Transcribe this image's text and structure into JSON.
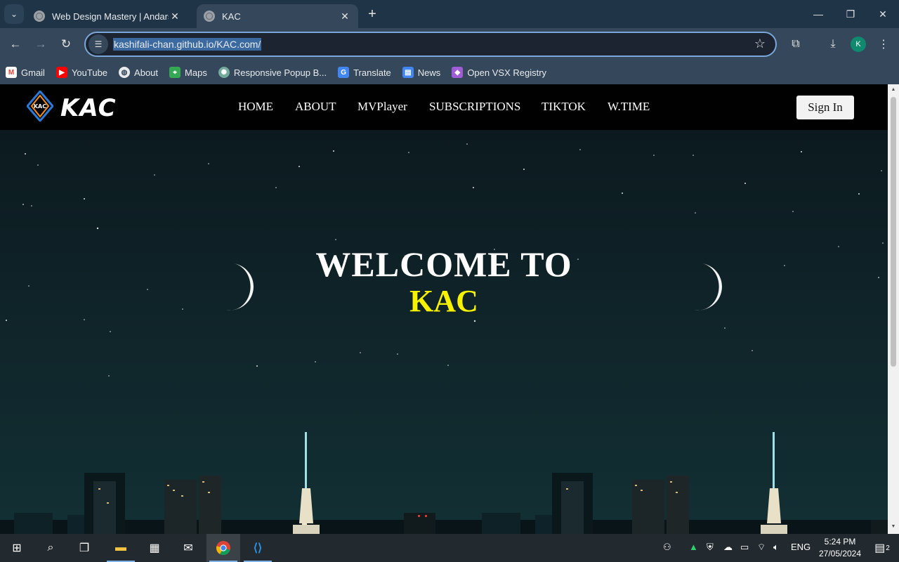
{
  "browser": {
    "tabs": [
      {
        "title": "Web Design Mastery | Andarson",
        "active": false
      },
      {
        "title": "KAC",
        "active": true
      }
    ],
    "url": "kashifali-chan.github.io/KAC.com/",
    "profile_initial": "K",
    "bookmarks": [
      {
        "label": "Gmail",
        "icon": "gmail-icon",
        "color": "#ea4335"
      },
      {
        "label": "YouTube",
        "icon": "youtube-icon",
        "color": "#ff0000"
      },
      {
        "label": "About",
        "icon": "globe-icon",
        "color": "#e8eaed"
      },
      {
        "label": "Maps",
        "icon": "maps-icon",
        "color": "#34a853"
      },
      {
        "label": "Responsive Popup B...",
        "icon": "chatgpt-icon",
        "color": "#74aa9c"
      },
      {
        "label": "Translate",
        "icon": "translate-icon",
        "color": "#4285f4"
      },
      {
        "label": "News",
        "icon": "news-icon",
        "color": "#4285f4"
      },
      {
        "label": "Open VSX Registry",
        "icon": "openvsx-icon",
        "color": "#a05bd6"
      }
    ]
  },
  "site": {
    "logo_badge": "KAC",
    "logo_text": "KAC",
    "nav": [
      "HOME",
      "ABOUT",
      "MVPlayer",
      "SUBSCRIPTIONS",
      "TIKTOK",
      "W.TIME"
    ],
    "signin_label": "Sign In",
    "hero": {
      "line1": "WELCOME TO",
      "line2": "KAC"
    },
    "colors": {
      "accent_yellow": "#f7f200",
      "nav_bg": "#010101",
      "night_sky": "#10262b"
    }
  },
  "taskbar": {
    "language": "ENG",
    "time": "5:24 PM",
    "date": "27/05/2024",
    "notification_count": "2"
  }
}
